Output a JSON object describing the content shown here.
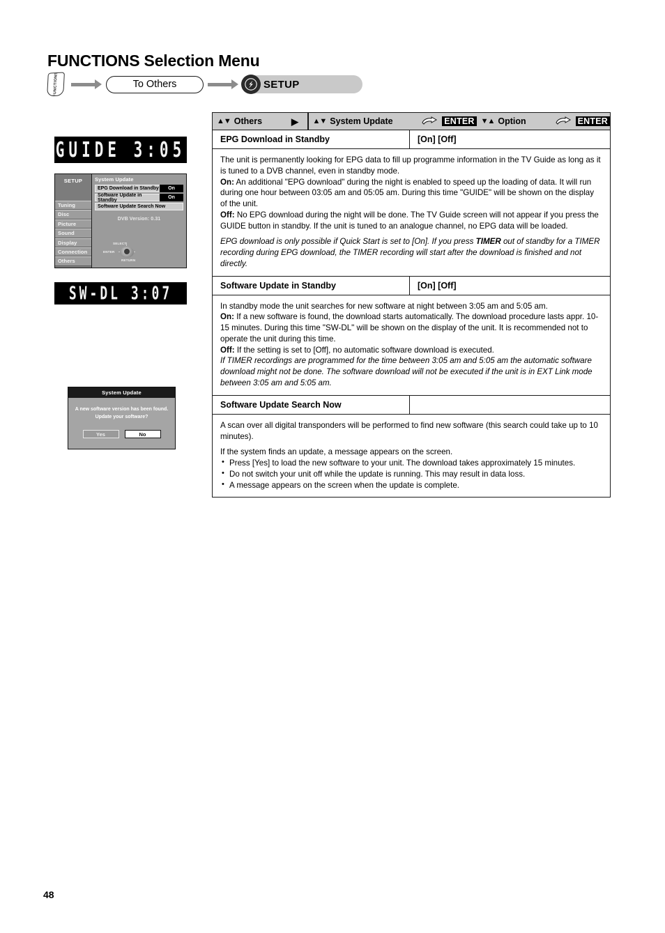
{
  "page": {
    "title_strong": "FUNCTIONS",
    "title_rest": " Selection Menu",
    "number": "48"
  },
  "breadcrumb": {
    "function_button_label": "FUNCTIONS",
    "step1": "To Others",
    "step2": "SETUP",
    "setup_icon": "setup-wrench-icon"
  },
  "led_displays": [
    {
      "name": "guide-display",
      "text": "GUIDE 3:05"
    },
    {
      "name": "swdl-display",
      "text": "SW-DL 3:07"
    }
  ],
  "osd": {
    "title": "SETUP",
    "categories": [
      "Tuning",
      "Disc",
      "Picture",
      "Sound",
      "Display",
      "Connection",
      "Others"
    ],
    "panel_title": "System Update",
    "rows": [
      {
        "label": "EPG  Download in Standby",
        "value": "On"
      },
      {
        "label": "Software Update in Standby",
        "value": "On"
      },
      {
        "label": "Software Update Search Now",
        "value": ""
      }
    ],
    "version": "DVB Version: 0.31",
    "nav": {
      "select": "SELECT",
      "enter": "ENTER",
      "return": "RETURN"
    }
  },
  "system_update_dialog": {
    "title": "System Update",
    "message_line1": "A new software version has been found.",
    "message_line2": "Update your software?",
    "yes": "Yes",
    "no": "No"
  },
  "navbar": {
    "others_label": "Others",
    "others_arrows": "▲▼",
    "right_arrow": "▶",
    "system_update_label": "System Update",
    "system_update_arrows": "▲▼",
    "enter_1": "ENTER",
    "option_label": "Option",
    "option_arrows": "▼▲",
    "enter_2": "ENTER",
    "hand_icon": "pointing-hand-icon"
  },
  "sections": [
    {
      "name": "EPG Download in Standby",
      "options": "[On] [Off]",
      "paragraphs": [
        {
          "type": "plain",
          "html": "The unit is permanently looking for EPG data to fill up programme information in the TV Guide as long as it is tuned to a DVB channel, even in standby mode."
        },
        {
          "type": "plain",
          "html": "<b>On:</b> An additional \"EPG download\" during the night is enabled to speed up the loading of data. It will run during one hour between 03:05 am and 05:05 am. During this time \"GUIDE\" will be shown on the display of the unit."
        },
        {
          "type": "plain",
          "html": "<b>Off:</b> No EPG download during the night will be done. The TV Guide screen will not appear if you press the GUIDE button in standby. If the unit is tuned to an analogue channel, no EPG data will be loaded."
        },
        {
          "type": "italic-gap",
          "html": "EPG download is only possible if Quick Start is set to [On]. If you press <b>TIMER</b> out of standby for a TIMER recording during EPG download, the TIMER recording will start after the download is finished and not directly."
        }
      ]
    },
    {
      "name": "Software Update in Standby",
      "options": "[On] [Off]",
      "paragraphs": [
        {
          "type": "plain",
          "html": "In standby mode the unit searches for new software at night between 3:05 am and 5:05 am."
        },
        {
          "type": "plain",
          "html": "<b>On:</b> If a new software is found, the download starts automatically. The download procedure lasts appr. 10-15 minutes. During this time \"SW-DL\" will be shown on the display of the unit. It is recommended not to operate the unit during this time."
        },
        {
          "type": "plain",
          "html": "<b>Off:</b> If the setting is set to [Off], no automatic software download is executed."
        },
        {
          "type": "italic",
          "html": "If TIMER recordings are programmed for the time between 3:05 am and 5:05 am the automatic software download might not be done. The software download will not be executed if the unit is in EXT Link mode between 3:05 am and 5:05 am."
        }
      ]
    },
    {
      "name": "Software Update Search Now",
      "options": "",
      "paragraphs": [
        {
          "type": "plain",
          "html": "A scan over all digital transponders will be performed to find new software (this search could take up to 10 minutes)."
        },
        {
          "type": "plain-gap",
          "html": "If the system finds an update, a message appears on the screen."
        }
      ],
      "bullets": [
        "Press [Yes] to load the new software to your unit. The download takes approximately 15 minutes.",
        "Do not switch your unit off while the update is running. This may result in data loss.",
        "A message appears on the screen when the update is complete."
      ]
    }
  ]
}
